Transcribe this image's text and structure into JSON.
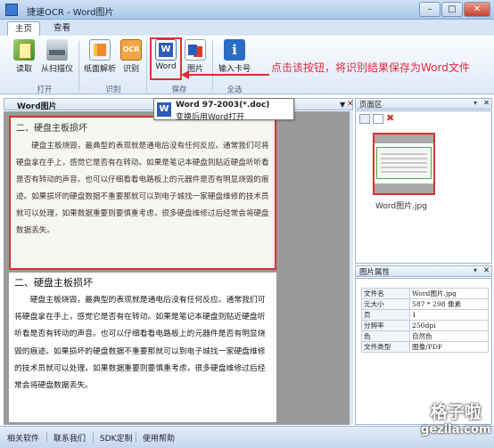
{
  "window": {
    "title": "捷速OCR - Word图片",
    "minimize": "–",
    "maximize": "□",
    "close": "✕"
  },
  "tabs": [
    {
      "label": "主页"
    },
    {
      "label": "查看"
    }
  ],
  "ribbon": {
    "groups": [
      {
        "label": "打开",
        "buttons": [
          {
            "label": "读取",
            "icon": "read-icon"
          },
          {
            "label": "从扫描仪",
            "icon": "scanner-icon"
          }
        ]
      },
      {
        "label": "识别",
        "buttons": [
          {
            "label": "纸面解析",
            "icon": "layout-icon"
          },
          {
            "label": "识别",
            "icon": "ocr-icon",
            "glyph": "OCR"
          }
        ]
      },
      {
        "label": "保存",
        "buttons": [
          {
            "label": "Word",
            "icon": "word-icon"
          },
          {
            "label": "图片",
            "icon": "image-icon"
          }
        ]
      },
      {
        "label": "全选",
        "buttons": [
          {
            "label": "输入卡号",
            "icon": "info-icon",
            "glyph": "i"
          }
        ]
      }
    ]
  },
  "annotation": {
    "text": "点击该按钮，将识别结果保存为Word文件",
    "color": "#e8283a"
  },
  "tooltip": {
    "title": "Word 97-2003(*.doc)",
    "subtitle": "变换后用Word打开"
  },
  "document_panel": {
    "tab_title": "Word图片",
    "source_page": {
      "heading": "二、硬盘主板损坏",
      "paragraph": "硬盘主板烧毁，最典型的表现就是通电后没有任何反应。通常我们可将硬盘拿在手上，感觉它是否有在转动。如果是笔记本硬盘则贴近硬盘听听看是否有转动的声音。也可以仔细看看电路板上的元器件是否有明显烧毁的痕迹。如果损坏的硬盘数据不重要那就可以到电子城找一家硬盘维修的技术员就可以处理，如果数据重要则要慎重考虑，很多硬盘维修过后经常会将硬盘数据丢失。"
    },
    "result_page": {
      "heading": "二、硬盘主板损坏",
      "paragraph": "硬盘主板烧毁，最典型的表现就是通电后没有任何反应。通常我们可将硬盘拿在手上，感觉它是否有在转动。如果是笔记本硬盘则贴近硬盘听听看是否有转动的声音。也可以仔细看看电路板上的元器件是否有明显烧毁的痕迹。如果损坏的硬盘数据不重要那就可以到电子城找一家硬盘维修的技术员就可以处理，如果数据重要则要慎重考虑，很多硬盘维修过后经常会将硬盘数据丢失。"
    }
  },
  "pages_panel": {
    "title": "页面区",
    "thumbnail_label": "Word图片.jpg"
  },
  "properties_panel": {
    "title": "图片属性",
    "rows": [
      {
        "key": "文件名",
        "value": "Word图片.jpg"
      },
      {
        "key": "元大小",
        "value": "587 * 298 像素"
      },
      {
        "key": "页",
        "value": "1"
      },
      {
        "key": "分辨率",
        "value": "250dpi"
      },
      {
        "key": "色",
        "value": "自然色"
      },
      {
        "key": "文件类型",
        "value": "图像/PDF"
      }
    ]
  },
  "statusbar": {
    "links": [
      "相关软件",
      "联系我们",
      "SDK定制",
      "使用帮助"
    ]
  },
  "watermark": {
    "line1": "格子啦",
    "line2": "gezila.com"
  }
}
